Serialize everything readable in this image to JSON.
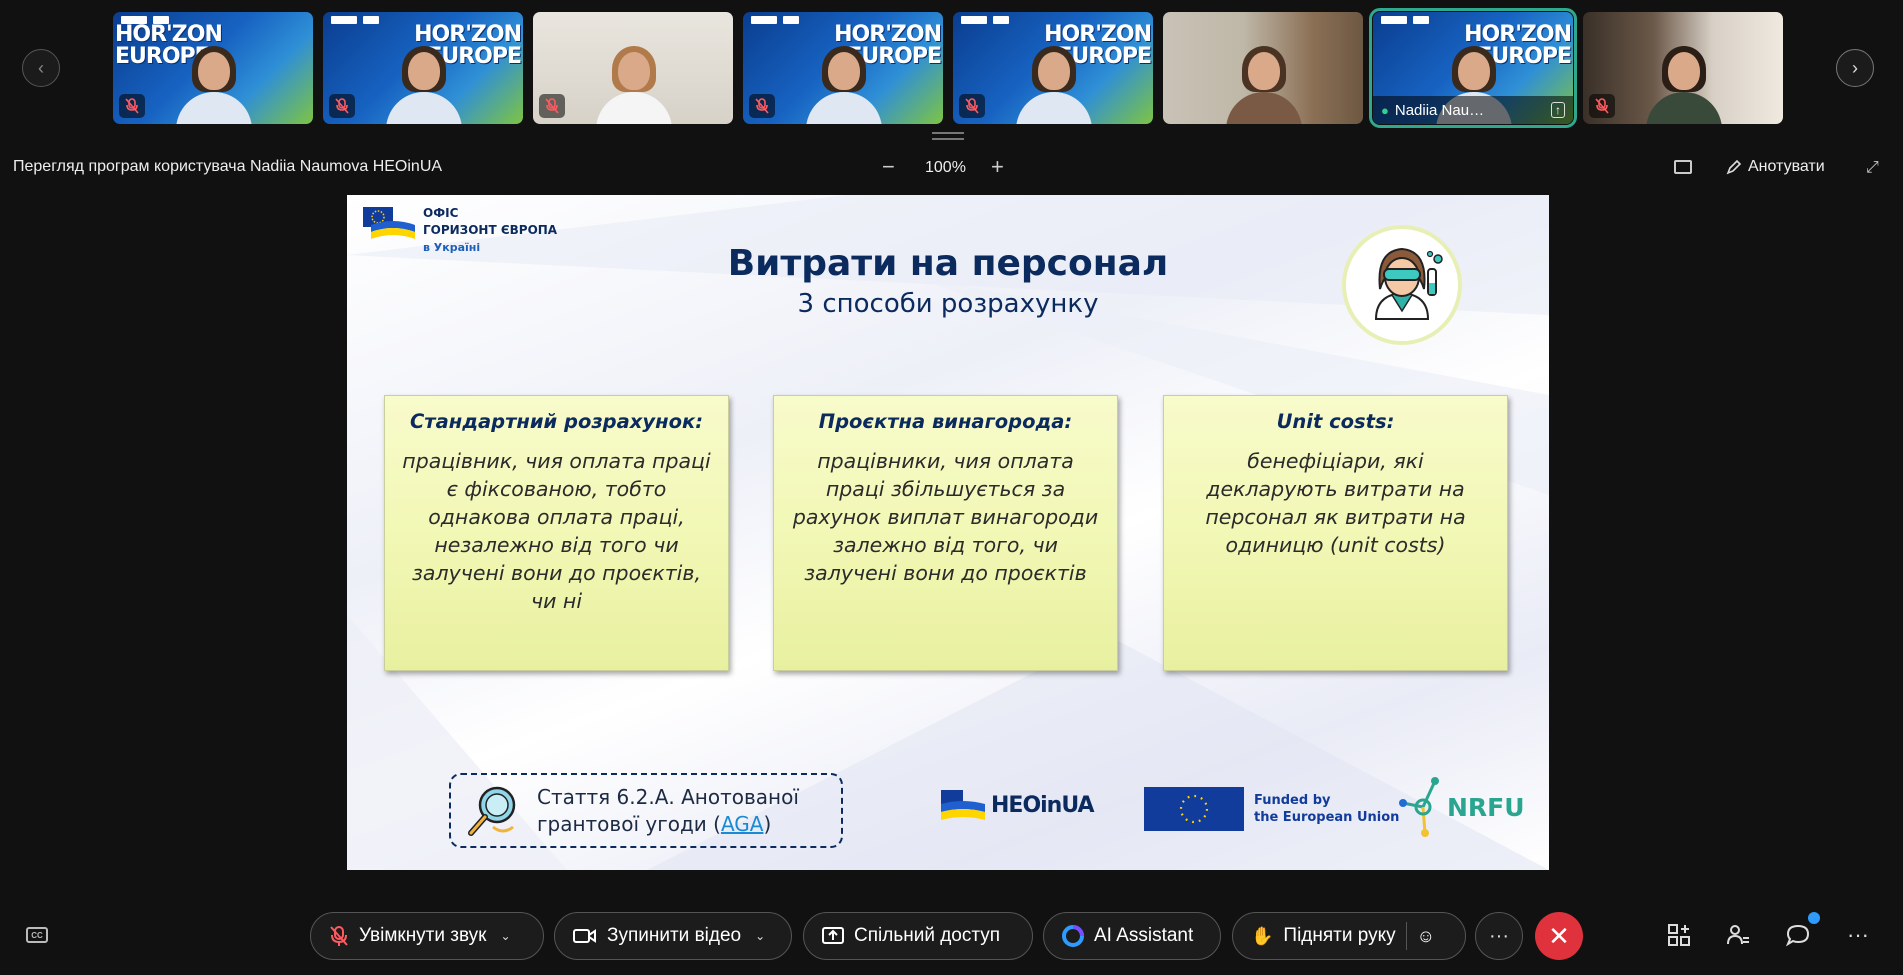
{
  "participants": [
    {
      "id": "p1",
      "name": "",
      "muted": true,
      "bg": "horizon",
      "horizon_text": "HOR'ZON\nEUROPE",
      "active": false
    },
    {
      "id": "p2",
      "name": "",
      "muted": true,
      "bg": "horizon",
      "horizon_text": "HOR'ZON\nEUROPE",
      "active": false
    },
    {
      "id": "p3",
      "name": "",
      "muted": true,
      "bg": "white",
      "active": false
    },
    {
      "id": "p4",
      "name": "",
      "muted": true,
      "bg": "horizon",
      "horizon_text": "HOR'ZON\nEUROPE",
      "active": false
    },
    {
      "id": "p5",
      "name": "",
      "muted": true,
      "bg": "horizon",
      "horizon_text": "HOR'ZON\nEUROPE",
      "active": false
    },
    {
      "id": "p6",
      "name": "",
      "muted": false,
      "bg": "shelf",
      "active": false
    },
    {
      "id": "p7",
      "name": "Nadiia Nau…",
      "muted": false,
      "bg": "horizon",
      "horizon_text": "HOR'ZON\nEUROPE",
      "active": true
    },
    {
      "id": "p8",
      "name": "",
      "muted": true,
      "bg": "room",
      "active": false
    }
  ],
  "share_header": {
    "title": "Перегляд програм користувача Nadiia Naumova HEOinUA",
    "zoom_out": "−",
    "zoom_level": "100%",
    "zoom_in": "+",
    "annotate_label": "Анотувати"
  },
  "slide": {
    "logo": {
      "line1": "ОФІС",
      "line2": "ГОРИЗОНТ ЄВРОПА",
      "line3": "в Україні"
    },
    "title": "Витрати на персонал",
    "subtitle": "3 способи розрахунку",
    "cards": [
      {
        "title": "Стандартний розрахунок:",
        "text": "працівник, чия оплата праці є фіксованою, тобто однакова оплата праці, незалежно від того чи залучені вони до проєктів, чи ні"
      },
      {
        "title": "Проєктна винагорода:",
        "text": "працівники, чия оплата праці збільшується за рахунок виплат винагороди залежно від того, чи залучені вони до проєктів"
      },
      {
        "title": "Unit costs:",
        "text": "бенефіціари, які декларують витрати на персонал як витрати на одиницю (unit costs)"
      }
    ],
    "aga": {
      "line1": "Стаття 6.2.А. Анотованої",
      "line2_prefix": "грантової угоди (",
      "link": "AGA",
      "line2_suffix": ")"
    },
    "footer": {
      "heoinua": "HEOinUA",
      "eu_funded_line1": "Funded by",
      "eu_funded_line2": "the European Union",
      "nrfu": "NRFU"
    }
  },
  "toolbar": {
    "unmute_label": "Увімкнути звук",
    "stop_video_label": "Зупинити відео",
    "share_label": "Спільний доступ",
    "ai_label": "AI Assistant",
    "raise_hand_label": "Підняти руку",
    "more_label": "···",
    "leave_label": "✕",
    "overflow_label": "···"
  },
  "colors": {
    "accent": "#2fa98e",
    "leave": "#e0323c",
    "slide_navy": "#0b2a5e",
    "card_yellow": "#f3f8b8",
    "chat_badge": "#2e9bff"
  }
}
